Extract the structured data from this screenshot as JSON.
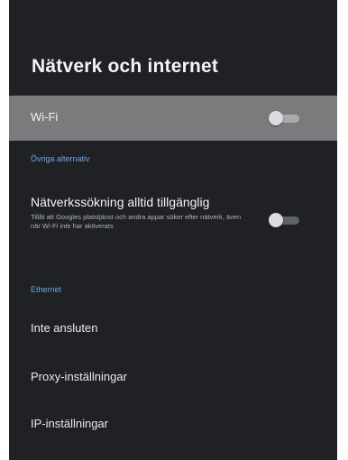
{
  "page": {
    "title": "Nätverk och internet"
  },
  "wifi": {
    "label": "Wi-Fi",
    "enabled": false
  },
  "other_options": {
    "header": "Övriga alternativ",
    "scan": {
      "label": "Nätverkssökning alltid tillgänglig",
      "description": "Tillåt att Googles platstjänst och andra appar söker efter nätverk, även när Wi-Fi inte har aktiverats",
      "enabled": false
    }
  },
  "ethernet": {
    "header": "Ethernet",
    "items": [
      {
        "label": "Inte ansluten"
      },
      {
        "label": "Proxy-inställningar"
      },
      {
        "label": "IP-inställningar"
      }
    ]
  },
  "colors": {
    "panel_bg": "#1f2124",
    "highlight_bg": "#7a7b7d",
    "section_accent": "#6fa7e8"
  }
}
